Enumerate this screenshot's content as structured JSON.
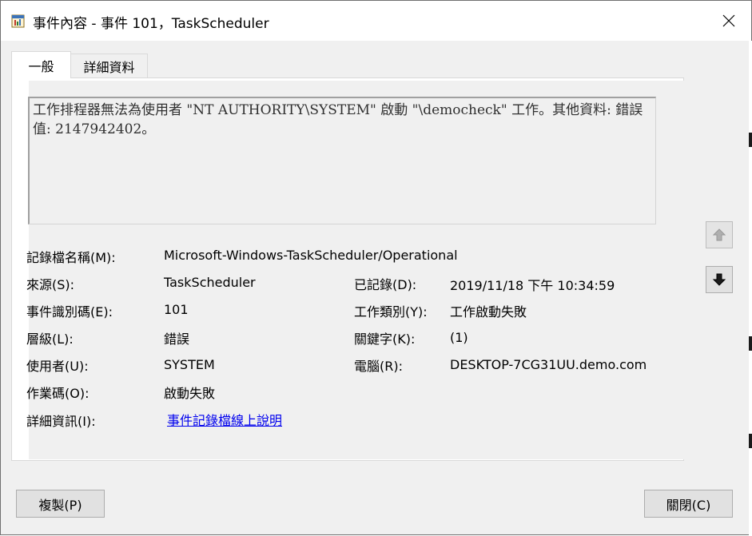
{
  "window": {
    "title": "事件內容 - 事件 101，TaskScheduler"
  },
  "tabs": [
    {
      "label": "一般"
    },
    {
      "label": "詳細資料"
    }
  ],
  "description": "工作排程器無法為使用者 \"NT AUTHORITY\\SYSTEM\" 啟動 \"\\democheck\" 工作。其他資料: 錯誤值: 2147942402。",
  "fields": {
    "log_name": {
      "label": "記錄檔名稱(M):",
      "value": "Microsoft-Windows-TaskScheduler/Operational"
    },
    "source": {
      "label": "來源(S):",
      "value": "TaskScheduler"
    },
    "logged": {
      "label": "已記錄(D):",
      "value": "2019/11/18 下午 10:34:59"
    },
    "event_id": {
      "label": "事件識別碼(E):",
      "value": "101"
    },
    "task_category": {
      "label": "工作類別(Y):",
      "value": "工作啟動失敗"
    },
    "level": {
      "label": "層級(L):",
      "value": "錯誤"
    },
    "keywords": {
      "label": "關鍵字(K):",
      "value": "(1)"
    },
    "user": {
      "label": "使用者(U):",
      "value": "SYSTEM"
    },
    "computer": {
      "label": "電腦(R):",
      "value": "DESKTOP-7CG31UU.demo.com"
    },
    "opcode": {
      "label": "作業碼(O):",
      "value": "啟動失敗"
    },
    "more_info": {
      "label": "詳細資訊(I):",
      "value": "事件記錄檔線上說明"
    }
  },
  "buttons": {
    "copy": "複製(P)",
    "close": "關閉(C)"
  },
  "icons": {
    "app": "event-viewer-icon",
    "close": "close-icon",
    "up": "arrow-up-icon",
    "down": "arrow-down-icon"
  },
  "colors": {
    "link": "#0000ee",
    "dialog_bg": "#f0f0f0"
  }
}
